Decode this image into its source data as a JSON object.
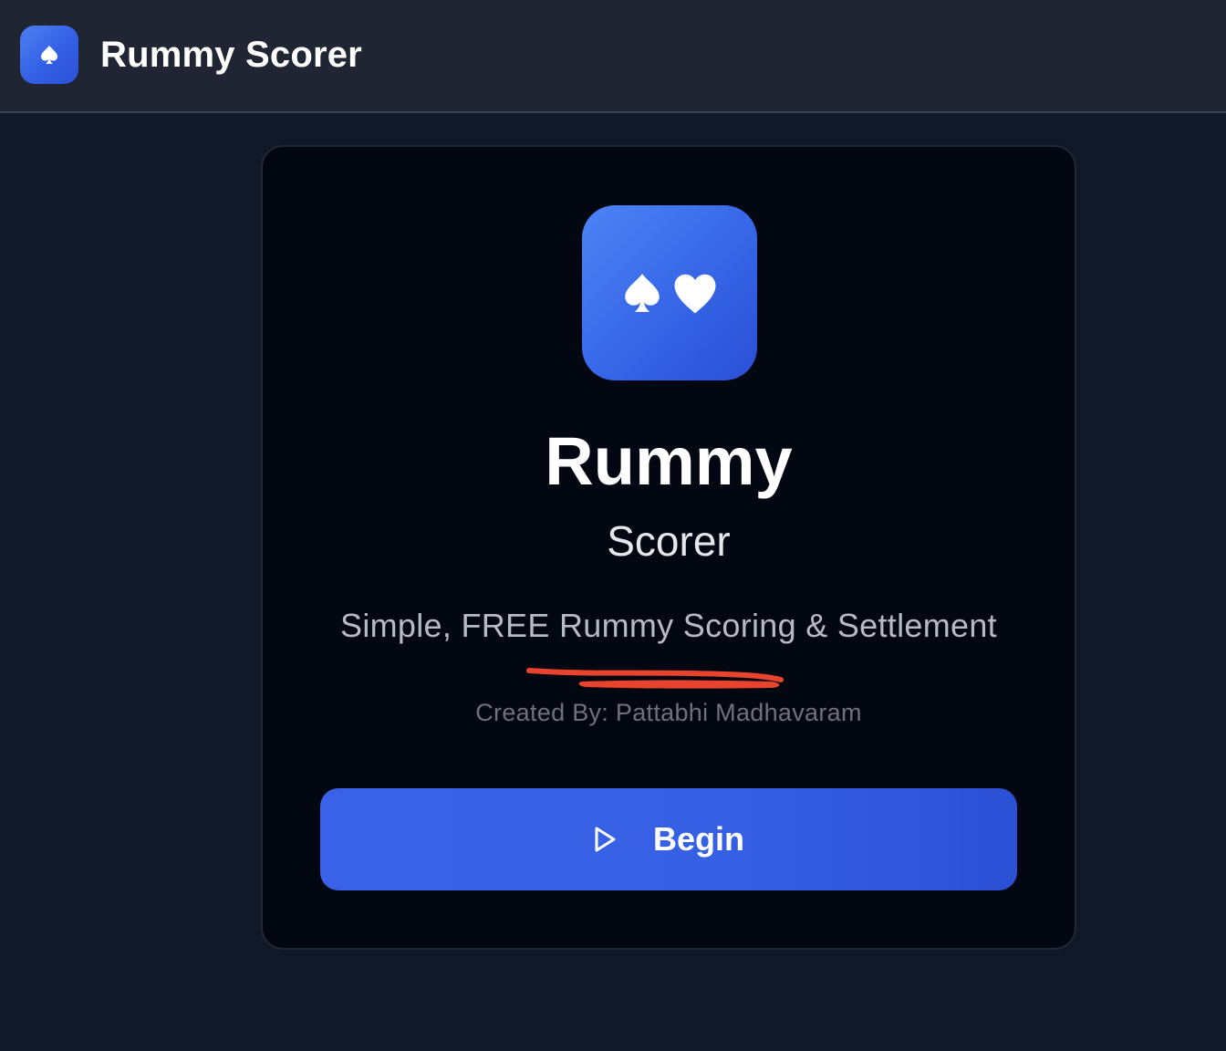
{
  "header": {
    "title": "Rummy Scorer",
    "logo_icon": "spade-icon"
  },
  "card": {
    "icon_symbols": [
      "spade-icon",
      "heart-icon"
    ],
    "title": "Rummy",
    "subtitle": "Scorer",
    "tagline": "Simple, FREE Rummy Scoring & Settlement",
    "credit": "Created By: Pattabhi Madhavaram",
    "begin_button": {
      "label": "Begin",
      "icon": "play-icon"
    }
  },
  "colors": {
    "accent": "#3660e4",
    "background": "#111827",
    "header_bg": "#1f2533",
    "card_bg": "#030712",
    "annotation": "#e8432d"
  }
}
